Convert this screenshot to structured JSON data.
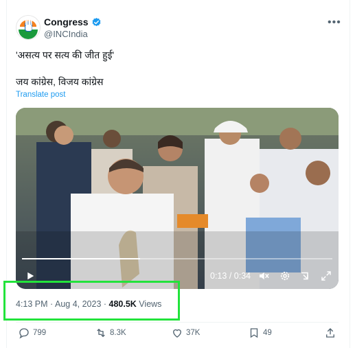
{
  "account": {
    "name": "Congress",
    "handle": "@INCIndia",
    "verified_icon": "verified-badge-icon"
  },
  "post": {
    "line1": "'असत्य पर सत्य की जीत हुई'",
    "line2": "जय कांग्रेस, विजय कांग्रेस",
    "translate_label": "Translate post"
  },
  "video": {
    "time_elapsed": "0:13",
    "time_sep": " / ",
    "time_total": "0:34",
    "progress_fraction": 0.38
  },
  "meta": {
    "time": "4:13 PM",
    "dot1": " · ",
    "date": "Aug 4, 2023",
    "dot2": " · ",
    "views_count": "480.5K",
    "views_label": " Views"
  },
  "actions": {
    "replies": "799",
    "reposts": "8.3K",
    "likes": "37K",
    "bookmarks": "49"
  },
  "colors": {
    "accent": "#1d9bf0",
    "highlight_box": "#22e33b",
    "muted_text": "#536471"
  }
}
